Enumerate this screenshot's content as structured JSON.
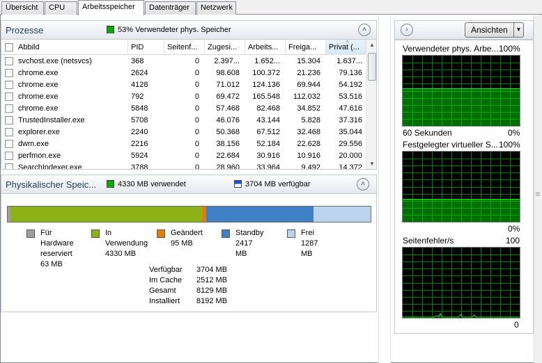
{
  "tabs": [
    "Übersicht",
    "CPU",
    "Arbeitsspeicher",
    "Datenträger",
    "Netzwerk"
  ],
  "processes": {
    "title": "Prozesse",
    "summary": "53% Verwendeter phys. Speicher",
    "summary_color": "#00c000",
    "columns": [
      "Abbild",
      "PID",
      "Seitenf...",
      "Zugesi...",
      "Arbeits...",
      "Freiga...",
      "Privat (..."
    ],
    "sorted_column": "Privat (...",
    "rows": [
      [
        "svchost.exe (netsvcs)",
        "368",
        "0",
        "2.397...",
        "1.652...",
        "15.304",
        "1.637..."
      ],
      [
        "chrome.exe",
        "2624",
        "0",
        "98.608",
        "100.372",
        "21.236",
        "79.136"
      ],
      [
        "chrome.exe",
        "4128",
        "0",
        "71.012",
        "124.136",
        "69.944",
        "54.192"
      ],
      [
        "chrome.exe",
        "792",
        "0",
        "69.472",
        "165.548",
        "112.032",
        "53.516"
      ],
      [
        "chrome.exe",
        "5848",
        "0",
        "57.468",
        "82.468",
        "34.852",
        "47.616"
      ],
      [
        "TrustedInstaller.exe",
        "5708",
        "0",
        "46.076",
        "43.144",
        "5.828",
        "37.316"
      ],
      [
        "explorer.exe",
        "2240",
        "0",
        "50.368",
        "67.512",
        "32.468",
        "35.044"
      ],
      [
        "dwm.exe",
        "2216",
        "0",
        "38.156",
        "52.184",
        "22.628",
        "29.556"
      ],
      [
        "perfmon.exe",
        "5924",
        "0",
        "22.684",
        "30.916",
        "10.916",
        "20.000"
      ],
      [
        "SearchIndexer.exe",
        "3788",
        "0",
        "28.960",
        "33.964",
        "9.492",
        "14.372"
      ]
    ]
  },
  "physical": {
    "title": "Physikalischer Speic...",
    "used_label": "4330 MB verwendet",
    "avail_label": "3704 MB verfügbar",
    "bar": [
      {
        "name": "Für Hardware reserviert",
        "mb": 63,
        "color": "#9f9f9f"
      },
      {
        "name": "In Verwendung",
        "mb": 4330,
        "color": "#8cb217"
      },
      {
        "name": "Geändert",
        "mb": 95,
        "color": "#e37d03"
      },
      {
        "name": "Standby",
        "mb": 2417,
        "color": "#3f7fc6"
      },
      {
        "name": "Frei",
        "mb": 1287,
        "color": "#bcd3ee"
      }
    ],
    "legend": [
      {
        "l1": "Für Hardware",
        "l2": "reserviert",
        "l3": "63 MB",
        "color": "#9f9f9f"
      },
      {
        "l1": "In",
        "l2": "Verwendung",
        "l3": "4330 MB",
        "color": "#8cb217"
      },
      {
        "l1": "Geändert",
        "l2": "95 MB",
        "l3": "",
        "color": "#e37d03"
      },
      {
        "l1": "Standby",
        "l2": "2417 MB",
        "l3": "",
        "color": "#3f7fc6"
      },
      {
        "l1": "Frei",
        "l2": "1287 MB",
        "l3": "",
        "color": "#bcd3ee"
      }
    ],
    "summary": [
      {
        "k": "Verfügbar",
        "v": "3704 MB"
      },
      {
        "k": "Im Cache",
        "v": "2512 MB"
      },
      {
        "k": "Gesamt",
        "v": "8129 MB"
      },
      {
        "k": "Installiert",
        "v": "8192 MB"
      }
    ]
  },
  "right": {
    "view_button": "Ansichten",
    "graphs": [
      {
        "label": "Verwendeter phys. Arbe...",
        "max": "100%",
        "bottom_left": "60 Sekunden",
        "bottom_right": "0%",
        "fill_fraction": 0.53
      },
      {
        "label": "Festgelegter virtueller S...",
        "max": "100%",
        "bottom_left": "",
        "bottom_right": "0%",
        "fill_fraction": 0.33
      },
      {
        "label": "Seitenfehler/s",
        "max": "100",
        "bottom_left": "",
        "bottom_right": "0",
        "fill_fraction": 0
      }
    ]
  },
  "colors": {
    "graph_bg": "#000000",
    "graph_grid": "#008000",
    "graph_line": "#00ff00",
    "header_text": "#1e395b"
  }
}
